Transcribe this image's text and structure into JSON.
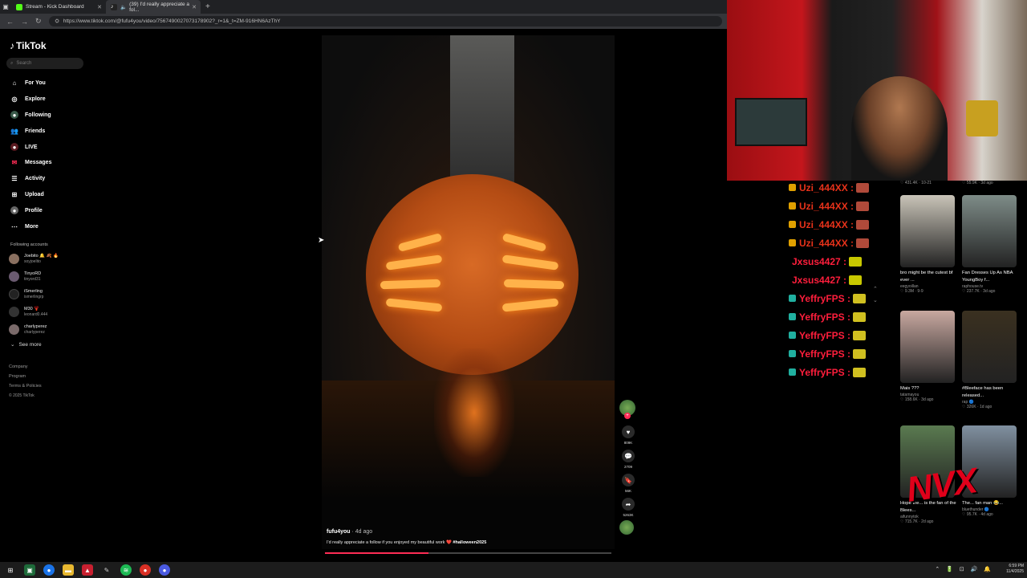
{
  "browser": {
    "tabs": [
      {
        "label": "Stream - Kick Dashboard",
        "color": "#53fc18"
      },
      {
        "label": "(39) I'd really appreciate a fol...",
        "color": "#ffffff"
      }
    ],
    "new_tab": "+",
    "url": "https://www.tiktok.com/@fufu4you/video/7567490027073178902?_r=1&_t=ZM-916HN6AzThY"
  },
  "tiktok": {
    "logo": "TikTok",
    "search_placeholder": "Search",
    "nav": [
      {
        "label": "For You",
        "icon": "home-icon"
      },
      {
        "label": "Explore",
        "icon": "compass-icon"
      },
      {
        "label": "Following",
        "icon": "following-icon"
      },
      {
        "label": "Friends",
        "icon": "friends-icon"
      },
      {
        "label": "LIVE",
        "icon": "live-icon"
      },
      {
        "label": "Messages",
        "icon": "message-icon"
      },
      {
        "label": "Activity",
        "icon": "activity-icon"
      },
      {
        "label": "Upload",
        "icon": "upload-icon"
      },
      {
        "label": "Profile",
        "icon": "profile-icon"
      },
      {
        "label": "More",
        "icon": "more-icon"
      }
    ],
    "following_title": "Following accounts",
    "accounts": [
      {
        "name": "Joebito 🔔 🍂 🔥",
        "handle": "soyjoelito"
      },
      {
        "name": "TinyoRD",
        "handle": "tinyord31"
      },
      {
        "name": "iSmerling",
        "handle": "ismerlingrp"
      },
      {
        "name": "M30 🦞",
        "handle": "leonard0.444"
      },
      {
        "name": "charlyperez",
        "handle": "charlyperez"
      }
    ],
    "see_more": "See more",
    "footer": [
      "Company",
      "Program",
      "Terms & Policies",
      "© 2025 TikTok"
    ],
    "video": {
      "author": "fufu4you",
      "age": "· 4d ago",
      "description": "I'd really appreciate a follow if you enjoyed my beautiful work ❤️",
      "hashtag": "#halloween2025",
      "likes": "809K",
      "comments": "2709",
      "saves": "56K",
      "shares": "5263K",
      "progress": 0.36
    }
  },
  "chat": [
    {
      "user": "Uzi_444XX :",
      "color": "#e8321a",
      "badge": "#e0a000",
      "emote": "#b04a3a"
    },
    {
      "user": "Uzi_444XX :",
      "color": "#e8321a",
      "badge": "#e0a000",
      "emote": "#b04a3a"
    },
    {
      "user": "Uzi_444XX :",
      "color": "#e8321a",
      "badge": "#e0a000",
      "emote": "#b04a3a"
    },
    {
      "user": "Uzi_444XX :",
      "color": "#e8321a",
      "badge": "#e0a000",
      "emote": "#b04a3a"
    },
    {
      "user": "Jxsus4427 :",
      "color": "#ff1e3c",
      "badge": "",
      "emote": "#c8c800"
    },
    {
      "user": "Jxsus4427 :",
      "color": "#ff1e3c",
      "badge": "",
      "emote": "#c8c800"
    },
    {
      "user": "YeffryFPS :",
      "color": "#ff1e3c",
      "badge": "#20b0a0",
      "emote": "#d0c020"
    },
    {
      "user": "YeffryFPS :",
      "color": "#ff1e3c",
      "badge": "#20b0a0",
      "emote": "#d0c020"
    },
    {
      "user": "YeffryFPS :",
      "color": "#ff1e3c",
      "badge": "#20b0a0",
      "emote": "#d0c020"
    },
    {
      "user": "YeffryFPS :",
      "color": "#ff1e3c",
      "badge": "#20b0a0",
      "emote": "#d0c020"
    },
    {
      "user": "YeffryFPS :",
      "color": "#ff1e3c",
      "badge": "#20b0a0",
      "emote": "#d0c020"
    }
  ],
  "recommended": {
    "top_meta": [
      "♡ 431.4K · 10-21",
      "♡ 55.9K · 3d ago"
    ],
    "cards": [
      {
        "title": "bro might be the cutest bf ever ...",
        "channel": "eegyoillan",
        "meta": "♡ 9.3M · 9-9",
        "thumb": "#c9c4b8"
      },
      {
        "title": "Fan Dresses Up As NBA YoungBoy f...",
        "channel": "raphouse.tv",
        "meta": "♡ 237.7K · 3d ago",
        "thumb": "#7e8c88"
      },
      {
        "title": "Mais ???",
        "channel": "tatamayou",
        "meta": "♡ 158.6K · 3d ago",
        "thumb": "#c8a8a0"
      },
      {
        "title": "#Bleeface has been released...",
        "channel": "rap 🔵",
        "meta": "♡ 326K · 1d ago",
        "thumb": "#3a3020"
      },
      {
        "title": "Hope the... is the fan of the Blees...",
        "channel": "aifunnytok",
        "meta": "♡ 715.7K · 2d ago",
        "thumb": "#5a7a50"
      },
      {
        "title": "The... fan man 😂...",
        "channel": "bluethunder 🔵",
        "meta": "♡ 95.7K · 4d ago",
        "thumb": "#8090a0"
      }
    ],
    "watermark": "NVX"
  },
  "taskbar": {
    "time": "6:59 PM",
    "date": "11/4/2025"
  }
}
